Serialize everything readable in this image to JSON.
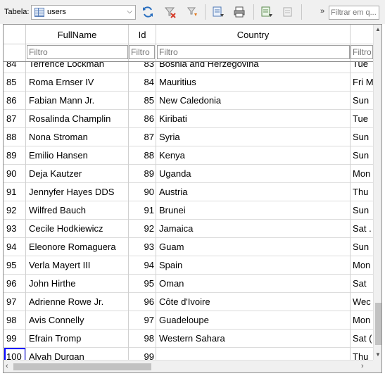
{
  "toolbar": {
    "table_label": "Tabela:",
    "selected_table": "users",
    "filter_placeholder": "Filtrar em q...",
    "more_label": "»",
    "icons": [
      "refresh-icon",
      "clear-filters-icon",
      "save-filters-icon",
      "insert-record-icon",
      "print-icon",
      "new-record-icon",
      "delete-record-icon"
    ]
  },
  "grid": {
    "columns": [
      {
        "key": "rownum",
        "label": ""
      },
      {
        "key": "FullName",
        "label": "FullName"
      },
      {
        "key": "Id",
        "label": "Id"
      },
      {
        "key": "Country",
        "label": "Country"
      },
      {
        "key": "extra",
        "label": ""
      }
    ],
    "filter_placeholder": "Filtro",
    "partial_row": {
      "rownum": "84",
      "FullName": "Terrence Lockman",
      "Id": "83",
      "Country": "Bosnia and Herzegovina",
      "extra": "Tue"
    },
    "rows": [
      {
        "rownum": "85",
        "FullName": "Roma Ernser IV",
        "Id": "84",
        "Country": "Mauritius",
        "extra": "Fri M"
      },
      {
        "rownum": "86",
        "FullName": "Fabian Mann Jr.",
        "Id": "85",
        "Country": "New Caledonia",
        "extra": "Sun"
      },
      {
        "rownum": "87",
        "FullName": "Rosalinda Champlin",
        "Id": "86",
        "Country": "Kiribati",
        "extra": "Tue"
      },
      {
        "rownum": "88",
        "FullName": "Nona Stroman",
        "Id": "87",
        "Country": "Syria",
        "extra": "Sun"
      },
      {
        "rownum": "89",
        "FullName": "Emilio Hansen",
        "Id": "88",
        "Country": "Kenya",
        "extra": "Sun"
      },
      {
        "rownum": "90",
        "FullName": "Deja Kautzer",
        "Id": "89",
        "Country": "Uganda",
        "extra": "Mon"
      },
      {
        "rownum": "91",
        "FullName": "Jennyfer Hayes DDS",
        "Id": "90",
        "Country": "Austria",
        "extra": "Thu"
      },
      {
        "rownum": "92",
        "FullName": "Wilfred Bauch",
        "Id": "91",
        "Country": "Brunei",
        "extra": "Sun"
      },
      {
        "rownum": "93",
        "FullName": "Cecile Hodkiewicz",
        "Id": "92",
        "Country": "Jamaica",
        "extra": "Sat ."
      },
      {
        "rownum": "94",
        "FullName": "Eleonore Romaguera",
        "Id": "93",
        "Country": "Guam",
        "extra": "Sun"
      },
      {
        "rownum": "95",
        "FullName": "Verla Mayert III",
        "Id": "94",
        "Country": "Spain",
        "extra": "Mon"
      },
      {
        "rownum": "96",
        "FullName": "John Hirthe",
        "Id": "95",
        "Country": "Oman",
        "extra": "Sat"
      },
      {
        "rownum": "97",
        "FullName": "Adrienne Rowe Jr.",
        "Id": "96",
        "Country": "Côte d'Ivoire",
        "extra": "Wec"
      },
      {
        "rownum": "98",
        "FullName": "Avis Connelly",
        "Id": "97",
        "Country": "Guadeloupe",
        "extra": "Mon"
      },
      {
        "rownum": "99",
        "FullName": "Efrain Tromp",
        "Id": "98",
        "Country": "Western Sahara",
        "extra": "Sat ("
      },
      {
        "rownum": "100",
        "FullName": "Alvah Durgan",
        "Id": "99",
        "Country": "",
        "extra": "Thu"
      }
    ],
    "selected_rownum": "100"
  },
  "colors": {
    "selection": "#0000ff",
    "grid_line": "#dcdcdc"
  }
}
